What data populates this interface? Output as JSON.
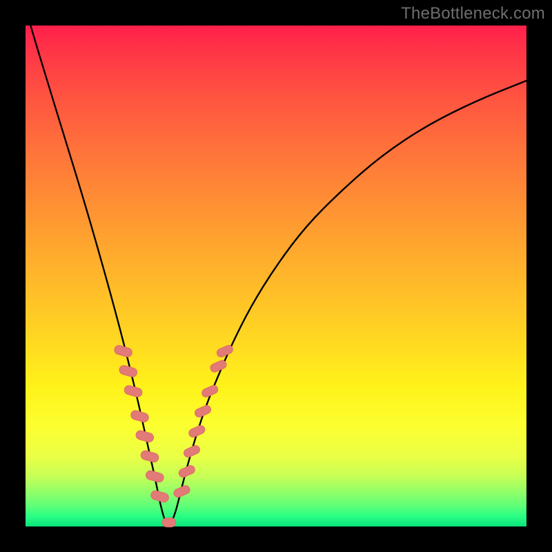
{
  "watermark": "TheBottleneck.com",
  "colors": {
    "frame": "#000000",
    "gradient_top": "#ff1f4b",
    "gradient_bottom": "#09e37a",
    "curve": "#000000",
    "marker_fill": "#e27a77",
    "marker_stroke": "#df6b67"
  },
  "chart_data": {
    "type": "line",
    "title": "",
    "xlabel": "",
    "ylabel": "",
    "xlim": [
      0,
      100
    ],
    "ylim": [
      0,
      100
    ],
    "curve": {
      "description": "V-shaped bottleneck curve; x in [0,100], y is mismatch percentage (0=green bottom, 100=red top). Left branch descends steeply from top-left to the minimum near x≈28; right branch ascends more slowly toward the upper-right.",
      "x": [
        1,
        4,
        8,
        12,
        16,
        19,
        22,
        24,
        26,
        27,
        28,
        29,
        30,
        31,
        32,
        34,
        36,
        38,
        41,
        45,
        50,
        56,
        63,
        71,
        80,
        90,
        100
      ],
      "y": [
        100,
        90,
        77,
        64,
        50,
        39,
        27,
        18,
        9,
        4,
        0.5,
        0.5,
        3,
        7,
        11,
        18,
        24,
        29,
        36,
        44,
        52,
        60,
        67,
        74,
        80,
        85,
        89
      ]
    },
    "markers": {
      "description": "Highlighted pill-shaped markers clustered near the valley on both branches (roughly y between 3 and 35).",
      "points_left": [
        {
          "x": 19.5,
          "y": 35
        },
        {
          "x": 20.5,
          "y": 31
        },
        {
          "x": 21.5,
          "y": 27
        },
        {
          "x": 22.8,
          "y": 22
        },
        {
          "x": 23.8,
          "y": 18
        },
        {
          "x": 24.8,
          "y": 14
        },
        {
          "x": 25.8,
          "y": 10
        },
        {
          "x": 26.8,
          "y": 6
        }
      ],
      "bottom_bar": {
        "x0": 27.3,
        "x1": 30.0,
        "y": 0.8
      },
      "points_right": [
        {
          "x": 31.2,
          "y": 7
        },
        {
          "x": 32.2,
          "y": 11
        },
        {
          "x": 33.2,
          "y": 15
        },
        {
          "x": 34.2,
          "y": 19
        },
        {
          "x": 35.4,
          "y": 23
        },
        {
          "x": 36.8,
          "y": 27
        },
        {
          "x": 38.5,
          "y": 32
        },
        {
          "x": 39.8,
          "y": 35
        }
      ]
    }
  }
}
